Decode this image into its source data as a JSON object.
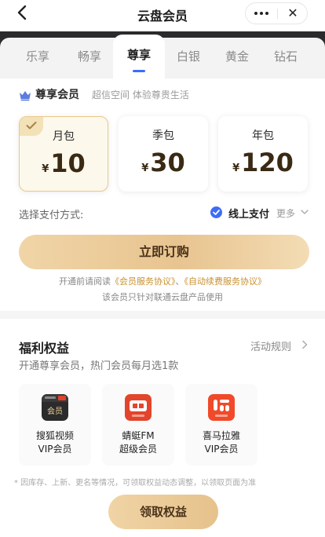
{
  "header": {
    "title": "云盘会员",
    "back_icon": "chevron-left-icon",
    "more_icon": "more-dots-icon",
    "close_icon": "close-icon",
    "close_glyph": "✕"
  },
  "tabs": [
    {
      "label": "乐享",
      "active": false
    },
    {
      "label": "畅享",
      "active": false
    },
    {
      "label": "尊享",
      "active": true
    },
    {
      "label": "白银",
      "active": false
    },
    {
      "label": "黄金",
      "active": false
    },
    {
      "label": "钻石",
      "active": false
    }
  ],
  "member": {
    "name": "尊享会员",
    "subtitle": "超信空间 体验尊贵生活",
    "icon": "crown-icon"
  },
  "plans": [
    {
      "name": "月包",
      "currency": "¥",
      "price": "10",
      "selected": true
    },
    {
      "name": "季包",
      "currency": "¥",
      "price": "30",
      "selected": false
    },
    {
      "name": "年包",
      "currency": "¥",
      "price": "120",
      "selected": false
    }
  ],
  "payment": {
    "label": "选择支付方式:",
    "method": "线上支付",
    "more": "更多"
  },
  "subscribe_label": "立即订购",
  "agreement": {
    "prefix": "开通前请阅读",
    "link1": "《会员服务协议》",
    "sep": "、",
    "link2": "《自动续费服务协议》"
  },
  "note": "该会员只针对联通云盘产品使用",
  "benefits": {
    "title": "福利权益",
    "rules": "活动规则",
    "subtitle": "开通尊享会员，热门会员每月选1款",
    "cards": [
      {
        "line1": "搜狐视频",
        "line2": "VIP会员",
        "logo_text": "会员",
        "logo_color": "#2a2a2a"
      },
      {
        "line1": "蜻蜓FM",
        "line2": "超级会员",
        "logo_text": "",
        "logo_color": "#e2452c"
      },
      {
        "line1": "喜马拉雅",
        "line2": "VIP会员",
        "logo_text": "",
        "logo_color": "#f04a2a"
      }
    ],
    "disclaimer": "* 因库存、上新、更名等情况，可领取权益动态调整，以领取页面为准",
    "claim_label": "领取权益"
  },
  "colors": {
    "accent_blue": "#3b6bff",
    "gold": "#e8c490",
    "link": "#c8902f"
  }
}
